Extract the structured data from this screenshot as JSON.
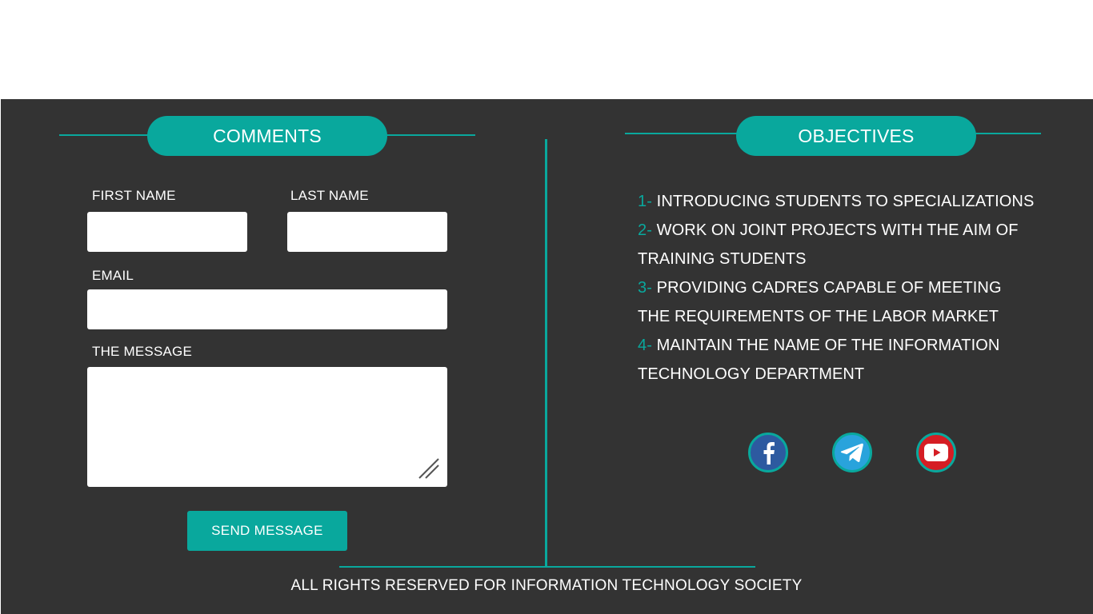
{
  "comments": {
    "title": "COMMENTS",
    "first_name_label": "FIRST NAME",
    "first_name_value": "",
    "last_name_label": "LAST NAME",
    "last_name_value": "",
    "email_label": "EMAIL",
    "email_value": "",
    "message_label": "THE MESSAGE",
    "message_value": "",
    "send_label": "SEND MESSAGE"
  },
  "objectives": {
    "title": "OBJECTIVES",
    "items": [
      {
        "num": "1-",
        "text": "INTRODUCING STUDENTS TO SPECIALIZATIONS"
      },
      {
        "num": "2-",
        "text": "WORK ON JOINT PROJECTS WITH THE AIM OF TRAINING STUDENTS"
      },
      {
        "num": "3-",
        "text": "PROVIDING CADRES CAPABLE OF MEETING THE REQUIREMENTS OF THE LABOR MARKET"
      },
      {
        "num": "4-",
        "text": "MAINTAIN THE NAME OF THE INFORMATION TECHNOLOGY DEPARTMENT"
      }
    ]
  },
  "social": [
    {
      "name": "facebook-icon",
      "color": "#2d5aa0"
    },
    {
      "name": "telegram-icon",
      "color": "#29a3dc"
    },
    {
      "name": "youtube-icon",
      "color": "#d51d24"
    }
  ],
  "footer": {
    "copyright": "ALL RIGHTS RESERVED FOR INFORMATION TECHNOLOGY SOCIETY"
  },
  "colors": {
    "accent": "#09a89d",
    "panel": "#333333",
    "text": "#ffffff"
  }
}
